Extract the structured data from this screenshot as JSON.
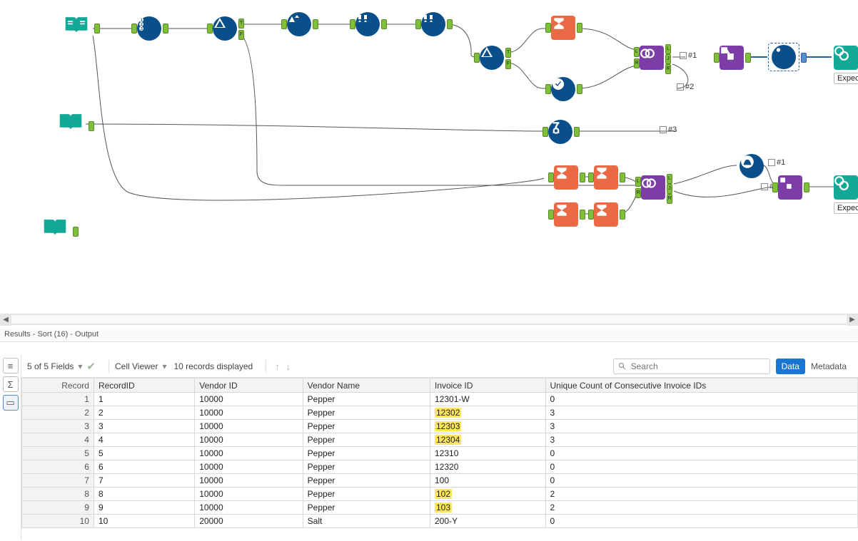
{
  "canvas": {
    "annotations": {
      "n1": "#1",
      "n2": "#2",
      "n3": "#3",
      "b1": "#1",
      "b2": "#2"
    },
    "labels": {
      "expected1": "Expected",
      "expected2": "Expec"
    }
  },
  "scrollbar": {
    "left_glyph": "◀",
    "right_glyph": "▶"
  },
  "results": {
    "title": "Results - Sort (16) - Output"
  },
  "toolbar": {
    "fields_count": "5 of 5 Fields",
    "cell_viewer": "Cell Viewer",
    "records_label": "10 records displayed",
    "search_placeholder": "Search",
    "data_btn": "Data",
    "metadata_btn": "Metadata"
  },
  "grid": {
    "columns": [
      "Record",
      "RecordID",
      "Vendor ID",
      "Vendor Name",
      "Invoice ID",
      "Unique Count of Consecutive Invoice IDs"
    ],
    "rows": [
      {
        "n": 1,
        "RecordID": "1",
        "VendorID": "10000",
        "VendorName": "Pepper",
        "InvoiceID": "12301-W",
        "Unique": "0",
        "hl": false
      },
      {
        "n": 2,
        "RecordID": "2",
        "VendorID": "10000",
        "VendorName": "Pepper",
        "InvoiceID": "12302",
        "Unique": "3",
        "hl": true
      },
      {
        "n": 3,
        "RecordID": "3",
        "VendorID": "10000",
        "VendorName": "Pepper",
        "InvoiceID": "12303",
        "Unique": "3",
        "hl": true
      },
      {
        "n": 4,
        "RecordID": "4",
        "VendorID": "10000",
        "VendorName": "Pepper",
        "InvoiceID": "12304",
        "Unique": "3",
        "hl": true
      },
      {
        "n": 5,
        "RecordID": "5",
        "VendorID": "10000",
        "VendorName": "Pepper",
        "InvoiceID": "12310",
        "Unique": "0",
        "hl": false
      },
      {
        "n": 6,
        "RecordID": "6",
        "VendorID": "10000",
        "VendorName": "Pepper",
        "InvoiceID": "12320",
        "Unique": "0",
        "hl": false
      },
      {
        "n": 7,
        "RecordID": "7",
        "VendorID": "10000",
        "VendorName": "Pepper",
        "InvoiceID": "100",
        "Unique": "0",
        "hl": false
      },
      {
        "n": 8,
        "RecordID": "8",
        "VendorID": "10000",
        "VendorName": "Pepper",
        "InvoiceID": "102",
        "Unique": "2",
        "hl": true
      },
      {
        "n": 9,
        "RecordID": "9",
        "VendorID": "10000",
        "VendorName": "Pepper",
        "InvoiceID": "103",
        "Unique": "2",
        "hl": true
      },
      {
        "n": 10,
        "RecordID": "10",
        "VendorID": "20000",
        "VendorName": "Salt",
        "InvoiceID": "200-Y",
        "Unique": "0",
        "hl": false
      }
    ]
  }
}
